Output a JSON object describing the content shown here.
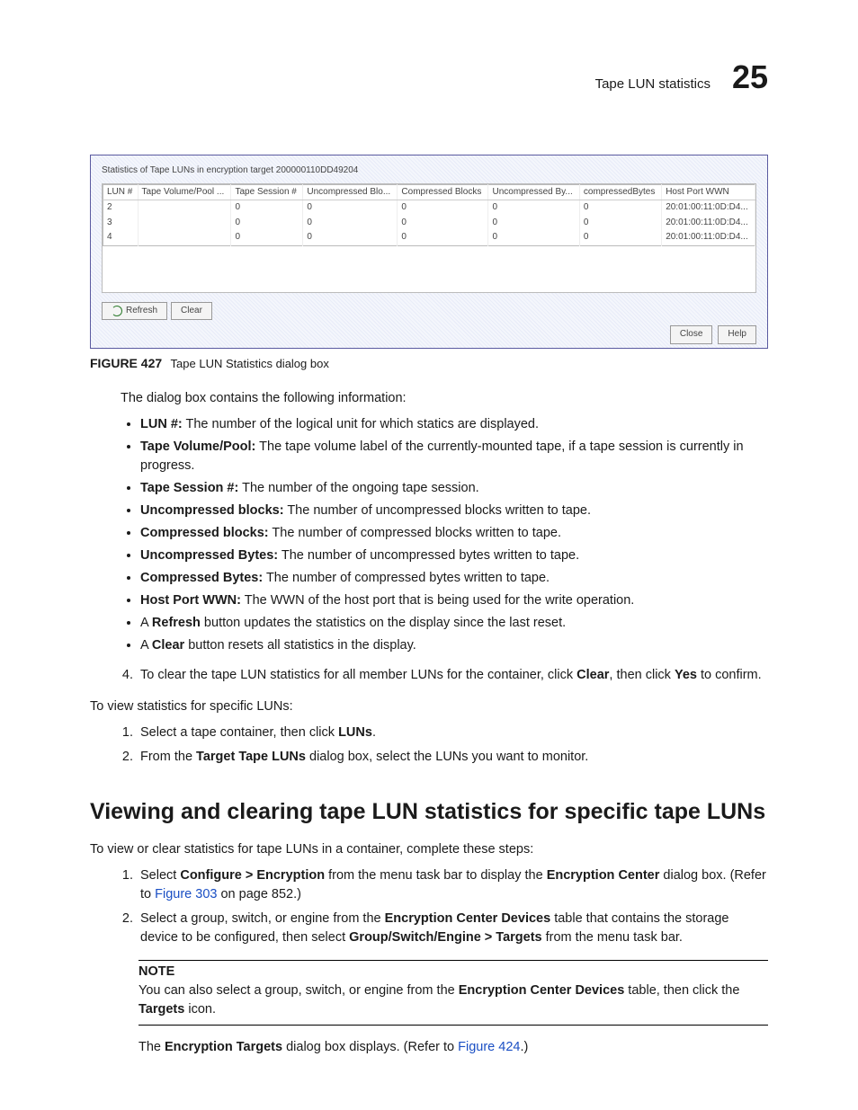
{
  "header": {
    "running_title": "Tape LUN statistics",
    "chapter_number": "25"
  },
  "screenshot": {
    "title": "Statistics of Tape LUNs in encryption target  200000110DD49204",
    "columns": [
      "LUN #",
      "Tape Volume/Pool ...",
      "Tape Session #",
      "Uncompressed Blo...",
      "Compressed Blocks",
      "Uncompressed By...",
      "compressedBytes",
      "Host Port WWN"
    ],
    "rows": [
      [
        "2",
        "",
        "0",
        "0",
        "0",
        "0",
        "0",
        "20:01:00:11:0D:D4..."
      ],
      [
        "3",
        "",
        "0",
        "0",
        "0",
        "0",
        "0",
        "20:01:00:11:0D:D4..."
      ],
      [
        "4",
        "",
        "0",
        "0",
        "0",
        "0",
        "0",
        "20:01:00:11:0D:D4..."
      ]
    ],
    "buttons": {
      "refresh": "Refresh",
      "clear": "Clear",
      "close": "Close",
      "help": "Help"
    }
  },
  "figure": {
    "label": "FIGURE 427",
    "caption": "Tape LUN Statistics dialog box"
  },
  "intro_line": "The dialog box contains the following information:",
  "bullets": [
    {
      "term": "LUN #:",
      "desc": " The number of the logical unit for which statics are displayed."
    },
    {
      "term": "Tape Volume/Pool:",
      "desc": " The tape volume label of the currently-mounted tape, if a tape session is currently in progress."
    },
    {
      "term": "Tape Session #:",
      "desc": " The number of the ongoing tape session."
    },
    {
      "term": "Uncompressed blocks:",
      "desc": " The number of uncompressed blocks written to tape."
    },
    {
      "term": "Compressed blocks:",
      "desc": " The number of compressed blocks written to tape."
    },
    {
      "term": "Uncompressed Bytes:",
      "desc": " The number of uncompressed bytes written to tape."
    },
    {
      "term": "Compressed Bytes:",
      "desc": " The number of compressed bytes written to tape."
    },
    {
      "term": "Host Port WWN:",
      "desc": " The WWN of the host port that is being used for the write operation."
    }
  ],
  "bullets_plain": {
    "refresh_pre": "A ",
    "refresh_term": "Refresh",
    "refresh_post": " button updates the statistics on the display since the last reset.",
    "clear_pre": "A ",
    "clear_term": "Clear",
    "clear_post": " button resets all statistics in the display."
  },
  "step4": {
    "pre": "To clear the tape LUN statistics for all member LUNs for the container, click ",
    "b1": "Clear",
    "mid": ", then click ",
    "b2": "Yes",
    "post": " to confirm."
  },
  "view_intro": "To view statistics for specific LUNs:",
  "view_steps": {
    "s1_pre": "Select a tape container, then click ",
    "s1_b": "LUNs",
    "s1_post": ".",
    "s2_pre": "From the ",
    "s2_b": "Target Tape LUNs",
    "s2_post": " dialog box, select the LUNs you want to monitor."
  },
  "section_heading": "Viewing and clearing tape LUN statistics for specific tape LUNs",
  "section_intro": "To view or clear statistics for tape LUNs in a container, complete these steps:",
  "sec_step1": {
    "pre": "Select ",
    "b1": "Configure > Encryption",
    "mid": " from the menu task bar to display the ",
    "b2": "Encryption Center",
    "post1": " dialog box. (Refer to ",
    "link": "Figure 303",
    "post2": " on page 852.)"
  },
  "sec_step2": {
    "pre": "Select a group, switch, or engine from the ",
    "b1": "Encryption Center Devices",
    "mid": " table that contains the storage device to be configured, then select ",
    "b2": "Group/Switch/Engine > Targets",
    "post": " from the menu task bar."
  },
  "note": {
    "title": "NOTE",
    "pre": "You can also select a group, switch, or engine from the ",
    "b1": "Encryption Center Devices",
    "mid": " table, then click the ",
    "b2": "Targets",
    "post": " icon."
  },
  "after_note": {
    "pre": "The ",
    "b1": "Encryption Targets",
    "mid": " dialog box displays. (Refer to ",
    "link": "Figure 424",
    "post": ".)"
  }
}
